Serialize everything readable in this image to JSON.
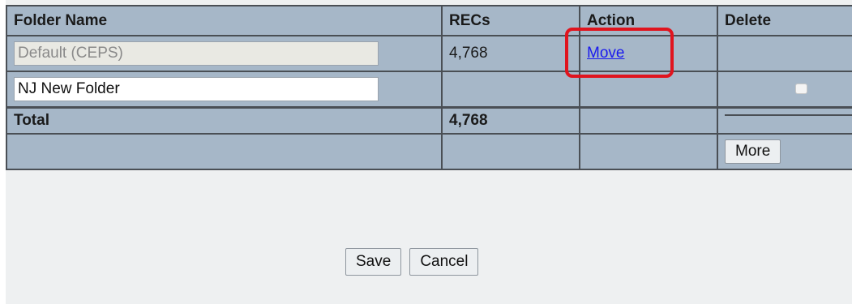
{
  "table": {
    "headers": [
      "Folder Name",
      "RECs",
      "Action",
      "Delete"
    ],
    "rows": [
      {
        "folder_name": "Default (CEPS)",
        "recs": "4,768",
        "action": "Move",
        "editable": false
      },
      {
        "folder_name": "NJ New Folder",
        "recs": "",
        "action": "",
        "editable": true
      }
    ],
    "total_label": "Total",
    "total_recs": "4,768"
  },
  "more_label": "More",
  "buttons": {
    "save": "Save",
    "cancel": "Cancel"
  },
  "colors": {
    "table_bg": "#a6b7c8",
    "highlight": "#e0141e",
    "link": "#1a1aee"
  }
}
